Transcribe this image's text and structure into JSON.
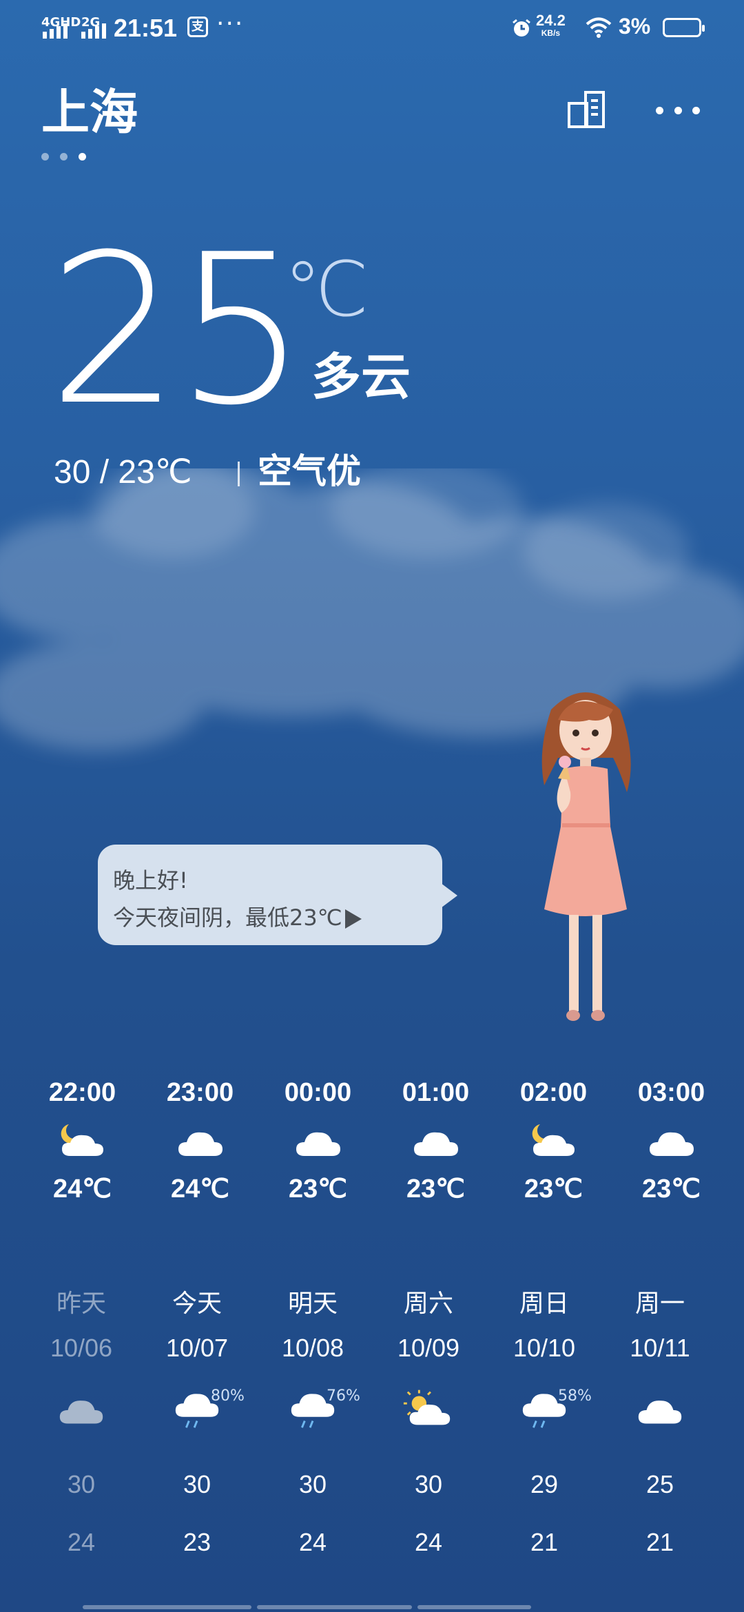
{
  "status_bar": {
    "network1": "4GHD",
    "network2": "2G",
    "time": "21:51",
    "pay_glyph": "支",
    "overflow": "···",
    "speed_value": "24.2",
    "speed_unit": "KB/s",
    "battery": "3%"
  },
  "header": {
    "city": "上海",
    "page_count": 3,
    "active_page": 3
  },
  "current": {
    "temperature": "25",
    "unit": "℃",
    "condition": "多云",
    "range": "30 / 23℃",
    "air_quality": "空气优"
  },
  "assistant": {
    "greeting": "晚上好!",
    "tip": "今天夜间阴，最低23℃"
  },
  "hourly": [
    {
      "time": "22:00",
      "icon": "partly-cloudy-night-icon",
      "temp": "24℃"
    },
    {
      "time": "23:00",
      "icon": "cloudy-icon",
      "temp": "24℃"
    },
    {
      "time": "00:00",
      "icon": "cloudy-icon",
      "temp": "23℃"
    },
    {
      "time": "01:00",
      "icon": "cloudy-icon",
      "temp": "23℃"
    },
    {
      "time": "02:00",
      "icon": "partly-cloudy-night-icon",
      "temp": "23℃"
    },
    {
      "time": "03:00",
      "icon": "cloudy-icon",
      "temp": "23℃"
    }
  ],
  "daily": [
    {
      "name": "昨天",
      "date": "10/06",
      "icon": "overcast-icon",
      "pop": "",
      "high": "30",
      "low": "24"
    },
    {
      "name": "今天",
      "date": "10/07",
      "icon": "rain-icon",
      "pop": "80%",
      "high": "30",
      "low": "23"
    },
    {
      "name": "明天",
      "date": "10/08",
      "icon": "rain-icon",
      "pop": "76%",
      "high": "30",
      "low": "24"
    },
    {
      "name": "周六",
      "date": "10/09",
      "icon": "partly-sunny-icon",
      "pop": "",
      "high": "30",
      "low": "24"
    },
    {
      "name": "周日",
      "date": "10/10",
      "icon": "rain-icon",
      "pop": "58%",
      "high": "29",
      "low": "21"
    },
    {
      "name": "周一",
      "date": "10/11",
      "icon": "cloudy-icon",
      "pop": "",
      "high": "25",
      "low": "21"
    }
  ],
  "colors": {
    "background_top": "#2b6aaf",
    "background_bottom": "#1f4885",
    "bubble": "#d6e1ee",
    "bubble_text": "#4a4f55"
  }
}
